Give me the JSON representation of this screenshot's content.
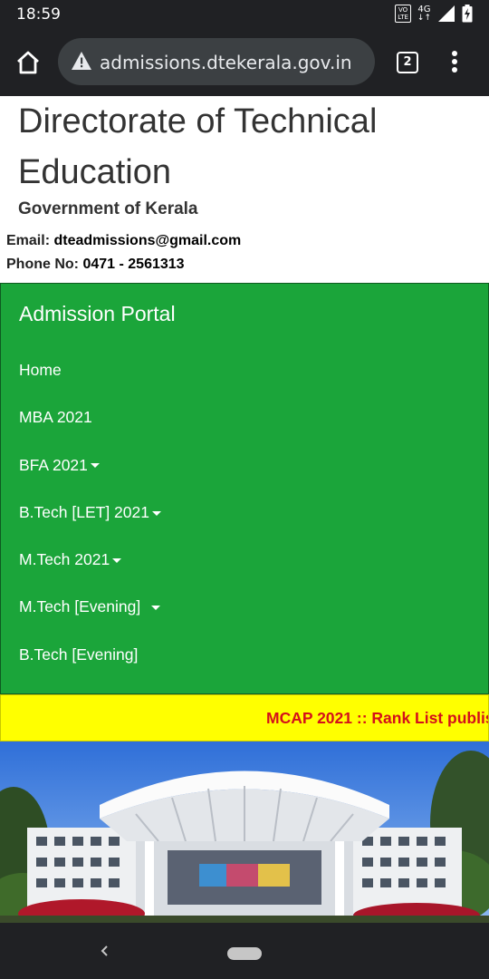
{
  "status_bar": {
    "time": "18:59",
    "volte_top": "VO",
    "volte_bottom": "LTE",
    "network": "4G",
    "icons": [
      "volte-icon",
      "4g-data-icon",
      "signal-icon",
      "battery-charging-icon"
    ]
  },
  "browser": {
    "url": "admissions.dtekerala.gov.in",
    "tab_count": "2",
    "icons": [
      "home-icon",
      "not-secure-warning-icon",
      "tabs-icon",
      "more-vert-icon"
    ]
  },
  "header": {
    "title": "Directorate of Technical Education",
    "subtitle": "Government of Kerala",
    "email_label": "Email:",
    "email": "dteadmissions@gmail.com",
    "phone_label": "Phone No:",
    "phone": "0471 - 2561313"
  },
  "navbar": {
    "brand": "Admission Portal",
    "items": [
      {
        "label": "Home",
        "dropdown": false
      },
      {
        "label": "MBA 2021",
        "dropdown": false
      },
      {
        "label": "BFA 2021",
        "dropdown": true
      },
      {
        "label": "B.Tech [LET] 2021",
        "dropdown": true
      },
      {
        "label": "M.Tech 2021",
        "dropdown": true
      },
      {
        "label": "M.Tech [Evening] ",
        "dropdown": true
      },
      {
        "label": "B.Tech [Evening]",
        "dropdown": false
      }
    ],
    "background_color": "#1ba53a"
  },
  "ticker": {
    "message": "MCAP 2021 :: Rank List publis",
    "background_color": "#ffff00",
    "text_color": "#d4101b"
  },
  "system_nav": {
    "icons": [
      "back-icon",
      "home-pill-icon"
    ]
  }
}
